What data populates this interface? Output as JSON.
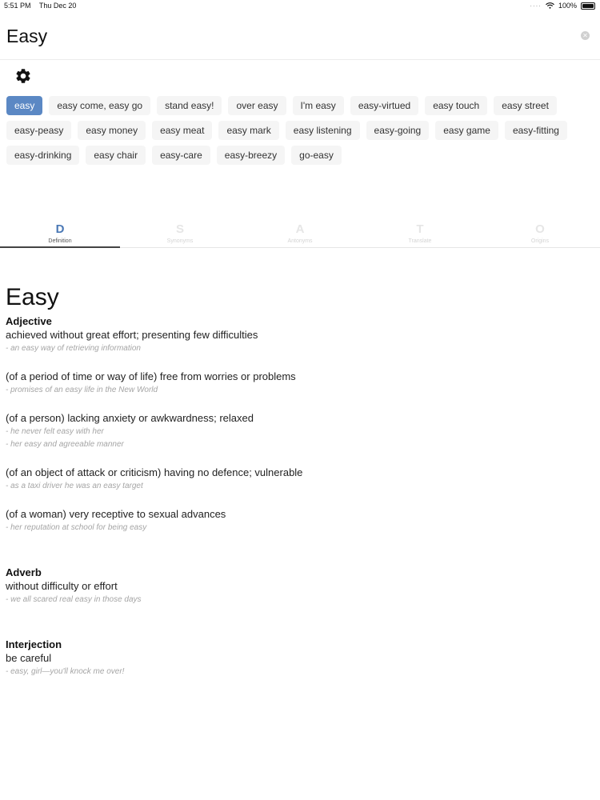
{
  "status_bar": {
    "time": "5:51 PM",
    "date": "Thu Dec 20",
    "battery": "100%"
  },
  "search": {
    "value": "Easy"
  },
  "chips": [
    [
      "easy",
      "easy come, easy go",
      "stand easy!",
      "over easy",
      "I'm easy",
      "easy-virtued",
      "easy touch",
      "easy street"
    ],
    [
      "easy-peasy",
      "easy money",
      "easy meat",
      "easy mark",
      "easy listening",
      "easy-going",
      "easy game",
      "easy-fitting"
    ],
    [
      "easy-drinking",
      "easy chair",
      "easy-care",
      "easy-breezy",
      "go-easy"
    ]
  ],
  "tabs": [
    {
      "glyph": "D",
      "label": "Definition"
    },
    {
      "glyph": "S",
      "label": "Synonyms"
    },
    {
      "glyph": "A",
      "label": "Antonyms"
    },
    {
      "glyph": "T",
      "label": "Translate"
    },
    {
      "glyph": "O",
      "label": "Origins"
    }
  ],
  "entry": {
    "word": "Easy",
    "groups": [
      {
        "pos": "Adjective",
        "senses": [
          {
            "def": "achieved without great effort; presenting few difficulties",
            "examples": [
              "- an easy way of retrieving information"
            ]
          },
          {
            "def": "(of a period of time or way of life) free from worries or problems",
            "examples": [
              "- promises of an easy life in the New World"
            ]
          },
          {
            "def": "(of a person) lacking anxiety or awkwardness; relaxed",
            "examples": [
              "- he never felt easy with her",
              "- her easy and agreeable manner"
            ]
          },
          {
            "def": "(of an object of attack or criticism) having no defence; vulnerable",
            "examples": [
              "- as a taxi driver he was an easy target"
            ]
          },
          {
            "def": "(of a woman) very receptive to sexual advances",
            "examples": [
              "- her reputation at school for being easy"
            ]
          }
        ]
      },
      {
        "pos": "Adverb",
        "senses": [
          {
            "def": "without difficulty or effort",
            "examples": [
              "- we all scared real easy in those days"
            ]
          }
        ]
      },
      {
        "pos": "Interjection",
        "senses": [
          {
            "def": "be careful",
            "examples": [
              "- easy, girl—you'll knock me over!"
            ]
          }
        ]
      }
    ]
  }
}
